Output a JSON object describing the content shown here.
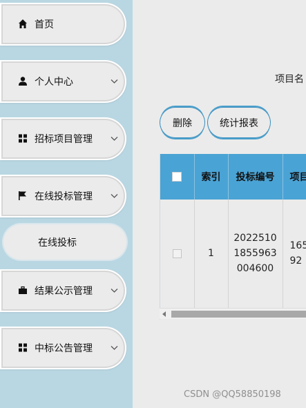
{
  "sidebar": {
    "items": [
      {
        "label": "首页",
        "icon": "home-icon",
        "has_chevron": false
      },
      {
        "label": "个人中心",
        "icon": "user-icon",
        "has_chevron": true
      },
      {
        "label": "招标项目管理",
        "icon": "grid-icon",
        "has_chevron": true
      },
      {
        "label": "在线投标管理",
        "icon": "flag-icon",
        "has_chevron": true
      },
      {
        "label": "结果公示管理",
        "icon": "briefcase-icon",
        "has_chevron": true
      },
      {
        "label": "中标公告管理",
        "icon": "grid-icon",
        "has_chevron": true
      }
    ],
    "sub_item": {
      "label": "在线投标"
    }
  },
  "main": {
    "search_label": "项目名",
    "toolbar": {
      "delete_label": "删除",
      "report_label": "统计报表"
    },
    "table": {
      "headers": [
        "",
        "索引",
        "投标编号",
        "项目"
      ],
      "rows": [
        {
          "index": "1",
          "bid_no_lines": [
            "2022510",
            "1855963",
            "004600"
          ],
          "project_lines": [
            "165",
            "92"
          ]
        }
      ]
    }
  },
  "watermark": "CSDN @QQ58850198",
  "colors": {
    "sidebar_bg": "#b9d7e3",
    "header_bg": "#4aa3d5",
    "button_accent": "#3a8fbf"
  }
}
